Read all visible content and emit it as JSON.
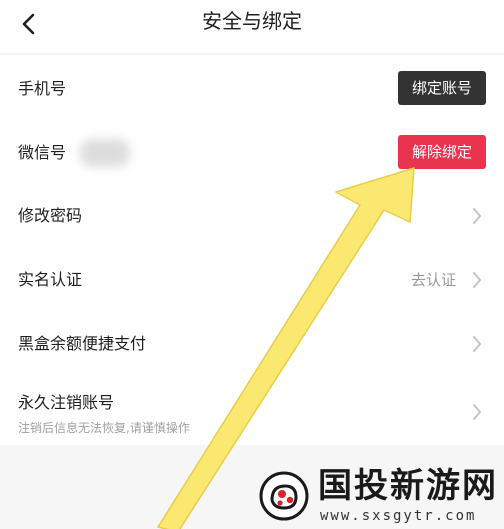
{
  "header": {
    "title": "安全与绑定",
    "back_icon": "chevron-left-icon"
  },
  "rows": {
    "phone": {
      "label": "手机号",
      "button_label": "绑定账号",
      "button_color": "#333333"
    },
    "wechat": {
      "label": "微信号",
      "button_label": "解除绑定",
      "button_color": "#e8344e"
    },
    "password": {
      "label": "修改密码"
    },
    "realname": {
      "label": "实名认证",
      "value": "去认证"
    },
    "pay": {
      "label": "黑盒余额便捷支付"
    },
    "cancel": {
      "label": "永久注销账号",
      "hint": "注销后信息无法恢复,请谨慎操作"
    }
  },
  "annotation": {
    "arrow_color": "#fbe871"
  },
  "watermark": {
    "title": "国投新游网",
    "url": "www.sxsgytr.com"
  },
  "colors": {
    "accent_red": "#e8344e",
    "dark_button": "#333333",
    "chevron": "#c4c4c4"
  }
}
